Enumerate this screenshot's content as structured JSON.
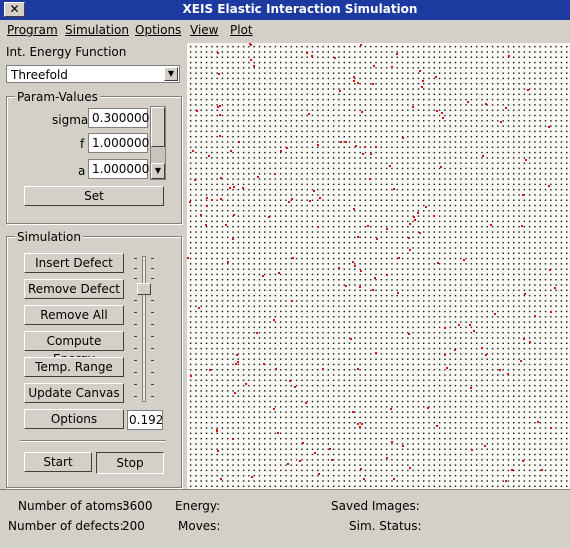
{
  "window": {
    "title": "XEIS Elastic Interaction Simulation",
    "close_glyph": "✕"
  },
  "menu": [
    {
      "label": "Program"
    },
    {
      "label": "Simulation"
    },
    {
      "label": "Options"
    },
    {
      "label": "View"
    },
    {
      "label": "Plot"
    }
  ],
  "energy_function": {
    "label": "Int. Energy Function",
    "selected": "Threefold"
  },
  "params": {
    "title": "Param-Values",
    "fields": [
      {
        "name": "sigma",
        "value": "0.300000"
      },
      {
        "name": "f",
        "value": "1.000000"
      },
      {
        "name": "a",
        "value": "1.000000"
      }
    ],
    "set_label": "Set"
  },
  "simulation": {
    "title": "Simulation",
    "buttons": [
      {
        "label": "Insert Defect"
      },
      {
        "label": "Remove Defect"
      },
      {
        "label": "Remove All"
      },
      {
        "label": "Compute Energy"
      },
      {
        "label": "Temp. Range"
      },
      {
        "label": "Update Canvas"
      },
      {
        "label": "Options"
      }
    ],
    "temperature_value": "0.192",
    "start_label": "Start",
    "stop_label": "Stop"
  },
  "status": {
    "atoms_label": "Number of atoms:",
    "atoms_value": "3600",
    "defects_label": "Number of defects:",
    "defects_value": "200",
    "energy_label": "Energy:",
    "moves_label": "Moves:",
    "saved_label": "Saved Images:",
    "simstatus_label": "Sim. Status:"
  },
  "colors": {
    "titlebar": "#1c3aa0",
    "defect": "#e01010",
    "canvas": "#fbf9f6"
  }
}
